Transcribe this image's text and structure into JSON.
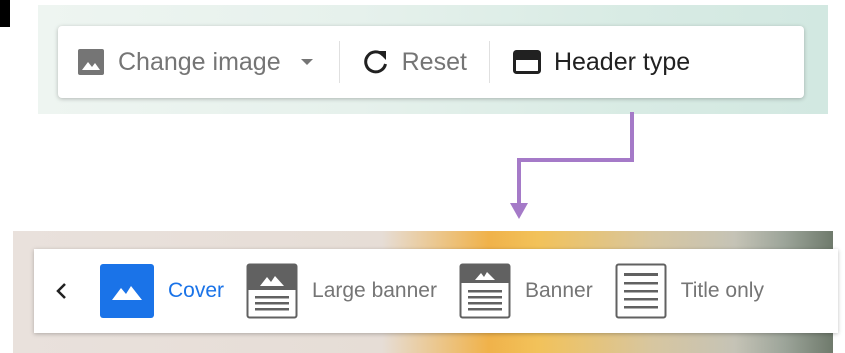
{
  "toolbar": {
    "change_image_label": "Change image",
    "reset_label": "Reset",
    "header_type_label": "Header type"
  },
  "header_type_picker": {
    "options": [
      {
        "label": "Cover",
        "icon": "cover-icon",
        "selected": true
      },
      {
        "label": "Large banner",
        "icon": "large-banner-icon",
        "selected": false
      },
      {
        "label": "Banner",
        "icon": "banner-icon",
        "selected": false
      },
      {
        "label": "Title only",
        "icon": "title-only-icon",
        "selected": false
      }
    ]
  },
  "colors": {
    "accent": "#1a73e8",
    "arrow": "#a57ac8",
    "icon_gray": "#757575",
    "icon_dark": "#212121"
  }
}
